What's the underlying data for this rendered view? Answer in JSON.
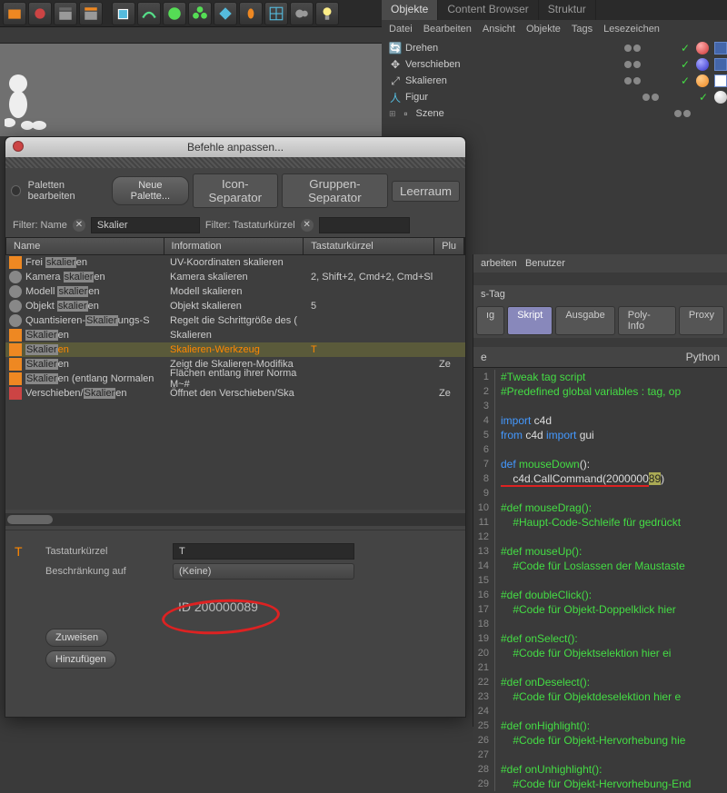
{
  "toolbar": {
    "icons": [
      "open",
      "record",
      "clapper",
      "clapper2",
      "cube",
      "spline",
      "sphere",
      "flower",
      "shape",
      "bulb",
      "grid",
      "camera",
      "light"
    ]
  },
  "objects_panel": {
    "tabs": [
      "Objekte",
      "Content Browser",
      "Struktur"
    ],
    "menu": [
      "Datei",
      "Bearbeiten",
      "Ansicht",
      "Objekte",
      "Tags",
      "Lesezeichen"
    ],
    "items": [
      {
        "name": "Drehen",
        "icon": "rotate",
        "sphere": "red"
      },
      {
        "name": "Verschieben",
        "icon": "move",
        "sphere": "blue"
      },
      {
        "name": "Skalieren",
        "icon": "scale",
        "sphere": "orange",
        "selected": true
      },
      {
        "name": "Figur",
        "icon": "figure",
        "sphere": "white"
      },
      {
        "name": "Szene",
        "icon": "scene"
      }
    ]
  },
  "dialog": {
    "title": "Befehle anpassen...",
    "palette_chk": "Paletten bearbeiten",
    "new_palette": "Neue Palette...",
    "icon_sep": "Icon-Separator",
    "group_sep": "Gruppen-Separator",
    "spacer": "Leerraum",
    "filter_name": "Filter: Name",
    "filter_name_val": "Skalier",
    "filter_key": "Filter: Tastaturkürzel",
    "cols": {
      "name": "Name",
      "info": "Information",
      "key": "Tastaturkürzel",
      "plu": "Plu"
    },
    "rows": [
      {
        "icon": "orange",
        "name_pre": "Frei ",
        "name_hl": "skalier",
        "name_post": "en",
        "info": "UV-Koordinaten skalieren",
        "key": ""
      },
      {
        "icon": "gear",
        "name_pre": "Kamera ",
        "name_hl": "skalier",
        "name_post": "en",
        "info": "Kamera skalieren",
        "key": "2, Shift+2, Cmd+2, Cmd+Sl"
      },
      {
        "icon": "gear",
        "name_pre": "Modell ",
        "name_hl": "skalier",
        "name_post": "en",
        "info": "Modell skalieren",
        "key": ""
      },
      {
        "icon": "gear",
        "name_pre": "Objekt ",
        "name_hl": "skalier",
        "name_post": "en",
        "info": "Objekt skalieren",
        "key": "5"
      },
      {
        "icon": "gear",
        "name_pre": "Quantisieren-",
        "name_hl": "Skalier",
        "name_post": "ungs-S",
        "info": "Regelt die Schrittgröße des (",
        "key": ""
      },
      {
        "icon": "orange",
        "name_pre": "",
        "name_hl": "Skalier",
        "name_post": "en",
        "info": "Skalieren",
        "key": ""
      },
      {
        "icon": "orange",
        "name_pre": "",
        "name_hl": "Skalier",
        "name_post": "en",
        "info": "Skalieren-Werkzeug",
        "key": "T",
        "selected": true
      },
      {
        "icon": "orange",
        "name_pre": "",
        "name_hl": "Skalier",
        "name_post": "en",
        "info": "Zeigt die Skalieren-Modifika",
        "key": "",
        "plu": "Ze"
      },
      {
        "icon": "orange",
        "name_pre": "",
        "name_hl": "Skalier",
        "name_post": "en (entlang Normalen",
        "info": "Flächen entlang ihrer Norma M~#",
        "key": ""
      },
      {
        "icon": "red",
        "name_pre": "Verschieben/",
        "name_hl": "Skalier",
        "name_post": "en",
        "info": "Öffnet den Verschieben/Ska",
        "key": "",
        "plu": "Ze"
      }
    ],
    "shortcut_lbl": "Tastaturkürzel",
    "shortcut_val": "T",
    "restrict_lbl": "Beschränkung auf",
    "restrict_val": "(Keine)",
    "id_label": "ID 200000089",
    "assign": "Zuweisen",
    "add": "Hinzufügen"
  },
  "attr_panel": {
    "menu": [
      "arbeiten",
      "Benutzer"
    ],
    "tag_label": "s-Tag",
    "tabs": [
      "ıg",
      "Skript",
      "Ausgabe",
      "Poly-Info",
      "Proxy"
    ],
    "lang": "Python"
  },
  "code": [
    {
      "n": 1,
      "t": "#Tweak tag script",
      "c": "comment"
    },
    {
      "n": 2,
      "t": "#Predefined global variables : tag, op",
      "c": "comment"
    },
    {
      "n": 3,
      "t": "",
      "c": "plain"
    },
    {
      "n": 4,
      "pre": "import",
      "post": " c4d",
      "c": "keyword"
    },
    {
      "n": 5,
      "pre": "from",
      "mid": " c4d ",
      "pre2": "import",
      "post": " gui",
      "c": "keyword"
    },
    {
      "n": 6,
      "t": "",
      "c": "plain"
    },
    {
      "n": 7,
      "pre": "def ",
      "func": "mouseDown",
      "post": "():",
      "c": "def"
    },
    {
      "n": 8,
      "t": "    c4d.CallCommand(2000000",
      "hl": "89",
      "post": ")",
      "c": "call"
    },
    {
      "n": 9,
      "t": "",
      "c": "plain"
    },
    {
      "n": 10,
      "t": "#def mouseDrag():",
      "c": "comment"
    },
    {
      "n": 11,
      "t": "    #Haupt-Code-Schleife für gedrückt",
      "c": "comment"
    },
    {
      "n": 12,
      "t": "",
      "c": "plain"
    },
    {
      "n": 13,
      "t": "#def mouseUp():",
      "c": "comment"
    },
    {
      "n": 14,
      "t": "    #Code für Loslassen der Maustaste",
      "c": "comment"
    },
    {
      "n": 15,
      "t": "",
      "c": "plain"
    },
    {
      "n": 16,
      "t": "#def doubleClick():",
      "c": "comment"
    },
    {
      "n": 17,
      "t": "    #Code für Objekt-Doppelklick hier",
      "c": "comment"
    },
    {
      "n": 18,
      "t": "",
      "c": "plain"
    },
    {
      "n": 19,
      "t": "#def onSelect():",
      "c": "comment"
    },
    {
      "n": 20,
      "t": "    #Code für Objektselektion hier ei",
      "c": "comment"
    },
    {
      "n": 21,
      "t": "",
      "c": "plain"
    },
    {
      "n": 22,
      "t": "#def onDeselect():",
      "c": "comment"
    },
    {
      "n": 23,
      "t": "    #Code für Objektdeselektion hier e",
      "c": "comment"
    },
    {
      "n": 24,
      "t": "",
      "c": "plain"
    },
    {
      "n": 25,
      "t": "#def onHighlight():",
      "c": "comment"
    },
    {
      "n": 26,
      "t": "    #Code für Objekt-Hervorhebung hie",
      "c": "comment"
    },
    {
      "n": 27,
      "t": "",
      "c": "plain"
    },
    {
      "n": 28,
      "t": "#def onUnhighlight():",
      "c": "comment"
    },
    {
      "n": 29,
      "t": "    #Code für Objekt-Hervorhebung-End",
      "c": "comment"
    }
  ]
}
